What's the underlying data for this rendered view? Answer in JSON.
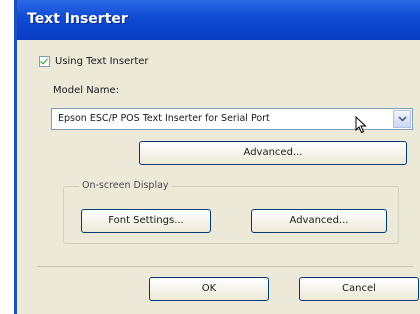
{
  "window": {
    "title": "Text Inserter"
  },
  "using_checkbox": {
    "label": "Using Text Inserter",
    "checked": true
  },
  "model_name": {
    "label": "Model Name:",
    "value": "Epson ESC/P POS Text Inserter for Serial Port"
  },
  "advanced_top": {
    "label": "Advanced..."
  },
  "onscreen_display": {
    "group_label": "On-screen Display",
    "font_settings_label": "Font Settings...",
    "advanced_label": "Advanced..."
  },
  "footer": {
    "ok_label": "OK",
    "cancel_label": "Cancel"
  },
  "colors": {
    "titlebar": "#0f4ad2",
    "dialog": "#ece9d8"
  }
}
